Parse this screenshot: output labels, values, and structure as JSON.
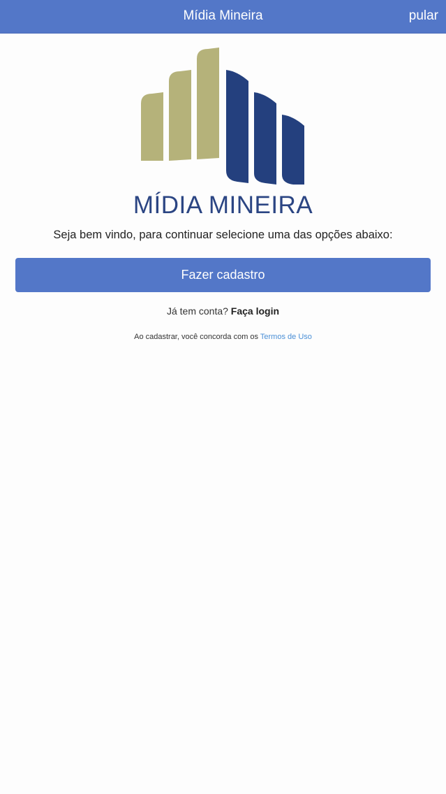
{
  "navbar": {
    "title": "Mídia Mineira",
    "skip_label": "pular"
  },
  "logo": {
    "icon": "building-bars-logo-icon",
    "colors": {
      "olive": "#b5b27a",
      "navy": "#24407e"
    }
  },
  "brand": {
    "name": "MÍDIA MINEIRA"
  },
  "welcome": {
    "text": "Seja bem vindo, para continuar selecione uma das opções abaixo:"
  },
  "signup": {
    "label": "Fazer cadastro"
  },
  "login": {
    "prompt": "Já tem conta?",
    "link_label": "Faça login"
  },
  "terms": {
    "prefix": "Ao cadastrar, você concorda com os",
    "link_label": "Termos de Uso"
  },
  "colors": {
    "accent": "#5377c8",
    "brand_text": "#2b4583",
    "link": "#4a8fd6"
  }
}
